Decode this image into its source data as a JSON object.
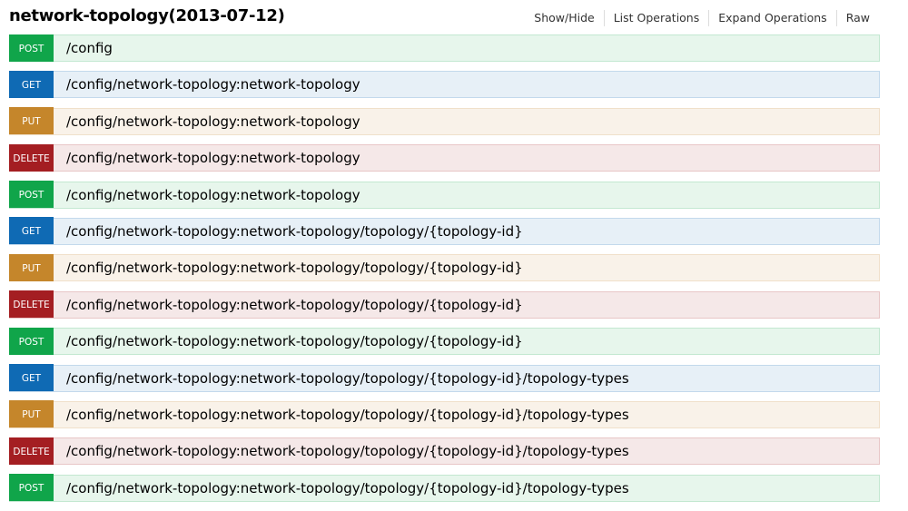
{
  "header": {
    "title": "network-topology(2013-07-12)",
    "links": {
      "show_hide": "Show/Hide",
      "list_operations": "List Operations",
      "expand_operations": "Expand Operations",
      "raw": "Raw"
    }
  },
  "colors": {
    "post": "#10a54a",
    "get": "#0f6ab4",
    "put": "#c5862b",
    "delete": "#a41e22"
  },
  "endpoints": [
    {
      "method": "POST",
      "path": "/config"
    },
    {
      "method": "GET",
      "path": "/config/network-topology:network-topology"
    },
    {
      "method": "PUT",
      "path": "/config/network-topology:network-topology"
    },
    {
      "method": "DELETE",
      "path": "/config/network-topology:network-topology"
    },
    {
      "method": "POST",
      "path": "/config/network-topology:network-topology"
    },
    {
      "method": "GET",
      "path": "/config/network-topology:network-topology/topology/{topology-id}"
    },
    {
      "method": "PUT",
      "path": "/config/network-topology:network-topology/topology/{topology-id}"
    },
    {
      "method": "DELETE",
      "path": "/config/network-topology:network-topology/topology/{topology-id}"
    },
    {
      "method": "POST",
      "path": "/config/network-topology:network-topology/topology/{topology-id}"
    },
    {
      "method": "GET",
      "path": "/config/network-topology:network-topology/topology/{topology-id}/topology-types"
    },
    {
      "method": "PUT",
      "path": "/config/network-topology:network-topology/topology/{topology-id}/topology-types"
    },
    {
      "method": "DELETE",
      "path": "/config/network-topology:network-topology/topology/{topology-id}/topology-types"
    },
    {
      "method": "POST",
      "path": "/config/network-topology:network-topology/topology/{topology-id}/topology-types"
    }
  ]
}
